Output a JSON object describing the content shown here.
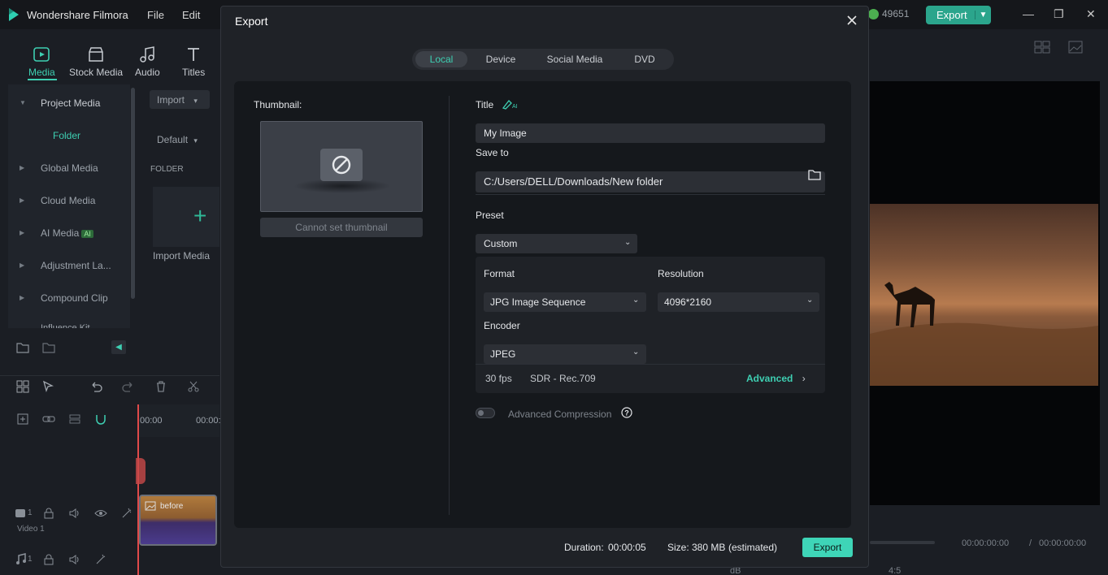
{
  "app": {
    "name": "Wondershare Filmora",
    "menu": [
      "File",
      "Edit"
    ],
    "credits": "49651",
    "export_label": "Export"
  },
  "toolbar": {
    "tools": [
      "Media",
      "Stock Media",
      "Audio",
      "Titles"
    ]
  },
  "library": {
    "items": [
      "Project Media",
      "Folder",
      "Global Media",
      "Cloud Media",
      "AI Media",
      "Adjustment La...",
      "Compound Clip",
      "Influence Kit"
    ],
    "ai_badge": "AI",
    "import_label": "Import",
    "sort_label": "Default",
    "folder_header": "FOLDER",
    "import_media_label": "Import Media"
  },
  "timeline": {
    "time_start": "00:00",
    "time_next": "00:00:",
    "clip_label": "before",
    "video_track_label": "Video 1",
    "video_track_num": "1",
    "audio_track_num": "1"
  },
  "preview": {
    "time_current": "00:00:00:00",
    "time_sep": "/",
    "time_total": "00:00:00:00",
    "ratio": "4:5",
    "db_label": "dB"
  },
  "export_dialog": {
    "title": "Export",
    "tabs": [
      "Local",
      "Device",
      "Social Media",
      "DVD"
    ],
    "active_tab": "Local",
    "thumbnail_label": "Thumbnail:",
    "thumbnail_button": "Cannot set thumbnail",
    "title_label": "Title",
    "title_value": "My Image",
    "save_to_label": "Save to",
    "save_to_value": "C:/Users/DELL/Downloads/New folder",
    "preset_label": "Preset",
    "preset_value": "Custom",
    "format_label": "Format",
    "format_value": "JPG Image Sequence",
    "resolution_label": "Resolution",
    "resolution_value": "4096*2160",
    "encoder_label": "Encoder",
    "encoder_value": "JPEG",
    "fps": "30 fps",
    "color_space": "SDR - Rec.709",
    "advanced_label": "Advanced",
    "advanced_compression_label": "Advanced Compression",
    "advanced_compression_on": false,
    "duration_label": "Duration:",
    "duration_value": "00:00:05",
    "size_label": "Size:",
    "size_value": "380 MB",
    "size_note": "(estimated)",
    "export_button": "Export"
  },
  "colors": {
    "accent": "#3ecfb2",
    "export_button": "#3ed5b7",
    "dialog_bg": "#1f2227",
    "playhead": "#e04a4a"
  }
}
